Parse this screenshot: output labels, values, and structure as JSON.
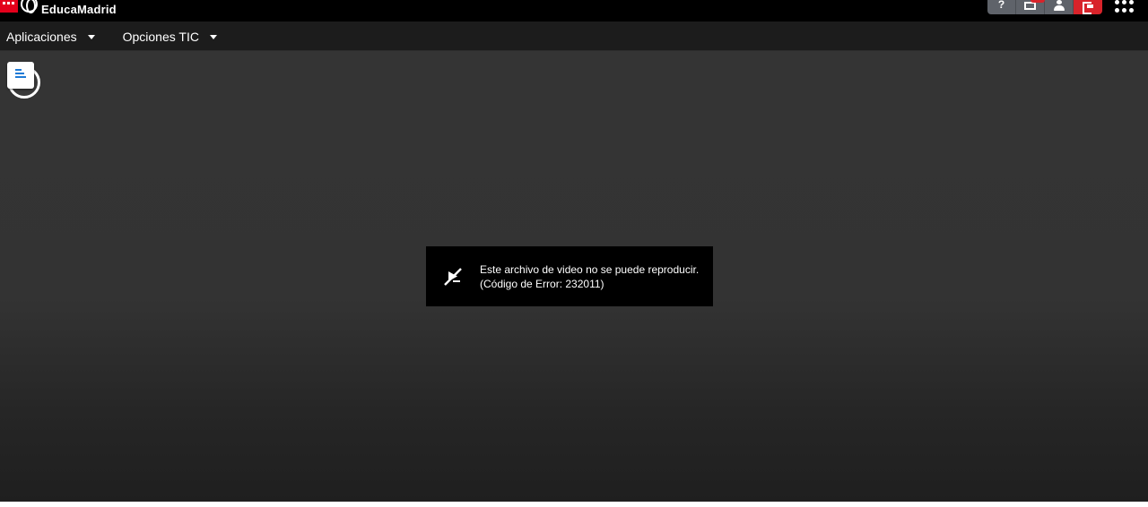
{
  "header": {
    "brand": "EducaMadrid",
    "actions": [
      {
        "name": "help",
        "icon": "help-icon",
        "label": "?"
      },
      {
        "name": "mail",
        "icon": "mail-icon"
      },
      {
        "name": "user",
        "icon": "user-icon"
      },
      {
        "name": "logout",
        "icon": "logout-icon"
      }
    ],
    "apps_icon": "apps-grid-icon"
  },
  "menu": {
    "items": [
      {
        "label": "Aplicaciones"
      },
      {
        "label": "Opciones TIC"
      }
    ]
  },
  "player": {
    "file_icon": "document-icon",
    "error": {
      "icon": "video-unavailable-icon",
      "line1": "Este archivo de video no se puede reproducir.",
      "line2": "(Código de Error: 232011)"
    }
  },
  "colors": {
    "accent_red": "#d8232a",
    "topbar": "#000000",
    "menubar": "#1c1c1c",
    "player_bg": "#333333"
  }
}
